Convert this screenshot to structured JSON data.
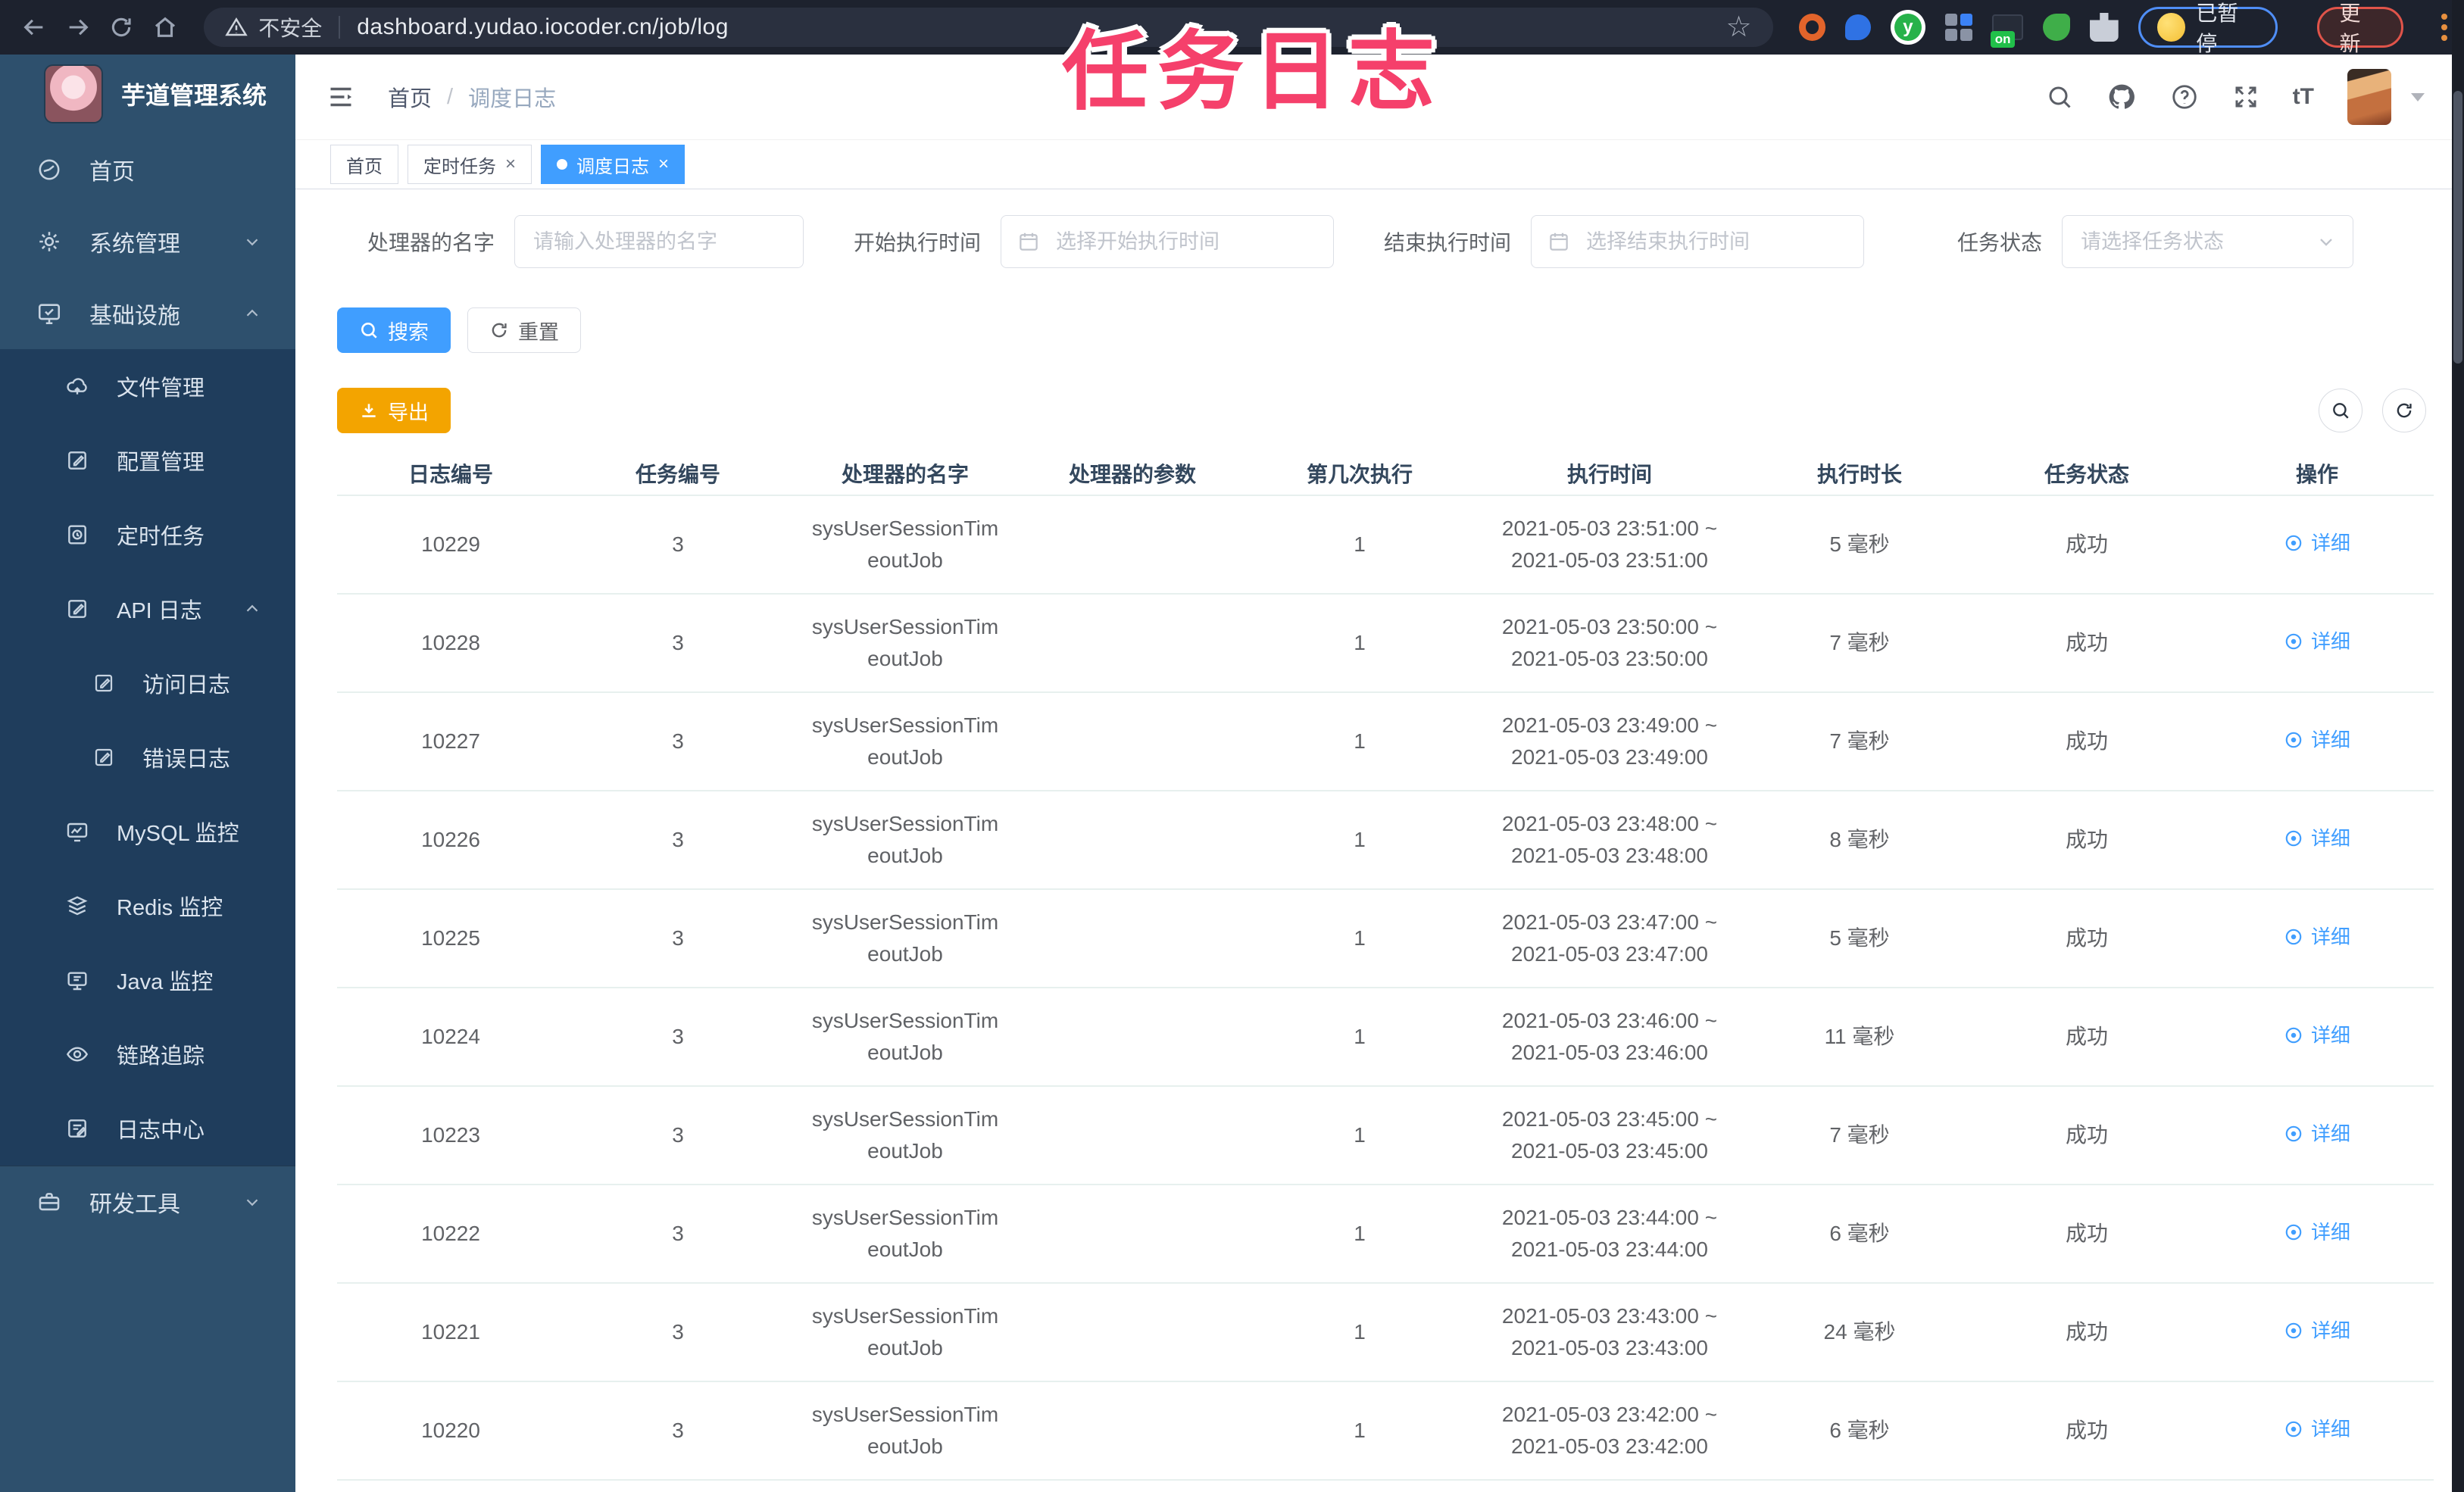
{
  "browser": {
    "security_label": "不安全",
    "url": "dashboard.yudao.iocoder.cn/job/log",
    "ext_on_label": "on",
    "paused_badge": "已暂停",
    "update_label": "更新"
  },
  "overlay": {
    "title": "任务日志",
    "color": "#f5406b"
  },
  "sidebar": {
    "app_title": "芋道管理系统",
    "items": [
      {
        "label": "首页"
      },
      {
        "label": "系统管理"
      },
      {
        "label": "基础设施"
      },
      {
        "label": "文件管理"
      },
      {
        "label": "配置管理"
      },
      {
        "label": "定时任务"
      },
      {
        "label": "API 日志"
      },
      {
        "label": "访问日志"
      },
      {
        "label": "错误日志"
      },
      {
        "label": "MySQL 监控"
      },
      {
        "label": "Redis 监控"
      },
      {
        "label": "Java 监控"
      },
      {
        "label": "链路追踪"
      },
      {
        "label": "日志中心"
      },
      {
        "label": "研发工具"
      }
    ]
  },
  "navbar": {
    "breadcrumb_home": "首页",
    "breadcrumb_current": "调度日志",
    "font_icon": "tT"
  },
  "tabs": [
    {
      "label": "首页"
    },
    {
      "label": "定时任务"
    },
    {
      "label": "调度日志"
    }
  ],
  "filters": {
    "handler_label": "处理器的名字",
    "handler_placeholder": "请输入处理器的名字",
    "begin_label": "开始执行时间",
    "begin_placeholder": "选择开始执行时间",
    "end_label": "结束执行时间",
    "end_placeholder": "选择结束执行时间",
    "status_label": "任务状态",
    "status_placeholder": "请选择任务状态"
  },
  "actions": {
    "search": "搜索",
    "reset": "重置",
    "export": "导出"
  },
  "table": {
    "columns": [
      "日志编号",
      "任务编号",
      "处理器的名字",
      "处理器的参数",
      "第几次执行",
      "执行时间",
      "执行时长",
      "任务状态",
      "操作"
    ],
    "rows": [
      {
        "log_id": "10229",
        "task_id": "3",
        "handler1": "sysUserSessionTim",
        "handler2": "eoutJob",
        "param": "",
        "exec_index": "1",
        "time1": "2021-05-03 23:51:00 ~",
        "time2": "2021-05-03 23:51:00",
        "duration": "5 毫秒",
        "status": "成功",
        "action": "详细"
      },
      {
        "log_id": "10228",
        "task_id": "3",
        "handler1": "sysUserSessionTim",
        "handler2": "eoutJob",
        "param": "",
        "exec_index": "1",
        "time1": "2021-05-03 23:50:00 ~",
        "time2": "2021-05-03 23:50:00",
        "duration": "7 毫秒",
        "status": "成功",
        "action": "详细"
      },
      {
        "log_id": "10227",
        "task_id": "3",
        "handler1": "sysUserSessionTim",
        "handler2": "eoutJob",
        "param": "",
        "exec_index": "1",
        "time1": "2021-05-03 23:49:00 ~",
        "time2": "2021-05-03 23:49:00",
        "duration": "7 毫秒",
        "status": "成功",
        "action": "详细"
      },
      {
        "log_id": "10226",
        "task_id": "3",
        "handler1": "sysUserSessionTim",
        "handler2": "eoutJob",
        "param": "",
        "exec_index": "1",
        "time1": "2021-05-03 23:48:00 ~",
        "time2": "2021-05-03 23:48:00",
        "duration": "8 毫秒",
        "status": "成功",
        "action": "详细"
      },
      {
        "log_id": "10225",
        "task_id": "3",
        "handler1": "sysUserSessionTim",
        "handler2": "eoutJob",
        "param": "",
        "exec_index": "1",
        "time1": "2021-05-03 23:47:00 ~",
        "time2": "2021-05-03 23:47:00",
        "duration": "5 毫秒",
        "status": "成功",
        "action": "详细"
      },
      {
        "log_id": "10224",
        "task_id": "3",
        "handler1": "sysUserSessionTim",
        "handler2": "eoutJob",
        "param": "",
        "exec_index": "1",
        "time1": "2021-05-03 23:46:00 ~",
        "time2": "2021-05-03 23:46:00",
        "duration": "11 毫秒",
        "status": "成功",
        "action": "详细"
      },
      {
        "log_id": "10223",
        "task_id": "3",
        "handler1": "sysUserSessionTim",
        "handler2": "eoutJob",
        "param": "",
        "exec_index": "1",
        "time1": "2021-05-03 23:45:00 ~",
        "time2": "2021-05-03 23:45:00",
        "duration": "7 毫秒",
        "status": "成功",
        "action": "详细"
      },
      {
        "log_id": "10222",
        "task_id": "3",
        "handler1": "sysUserSessionTim",
        "handler2": "eoutJob",
        "param": "",
        "exec_index": "1",
        "time1": "2021-05-03 23:44:00 ~",
        "time2": "2021-05-03 23:44:00",
        "duration": "6 毫秒",
        "status": "成功",
        "action": "详细"
      },
      {
        "log_id": "10221",
        "task_id": "3",
        "handler1": "sysUserSessionTim",
        "handler2": "eoutJob",
        "param": "",
        "exec_index": "1",
        "time1": "2021-05-03 23:43:00 ~",
        "time2": "2021-05-03 23:43:00",
        "duration": "24 毫秒",
        "status": "成功",
        "action": "详细"
      },
      {
        "log_id": "10220",
        "task_id": "3",
        "handler1": "sysUserSessionTim",
        "handler2": "eoutJob",
        "param": "",
        "exec_index": "1",
        "time1": "2021-05-03 23:42:00 ~",
        "time2": "2021-05-03 23:42:00",
        "duration": "6 毫秒",
        "status": "成功",
        "action": "详细"
      }
    ]
  },
  "colors": {
    "accent": "#409eff",
    "warning": "#f3a400",
    "sidebar": "#2e506d",
    "submenu": "#1f3d5c",
    "overlay_pink": "#f5406b"
  }
}
